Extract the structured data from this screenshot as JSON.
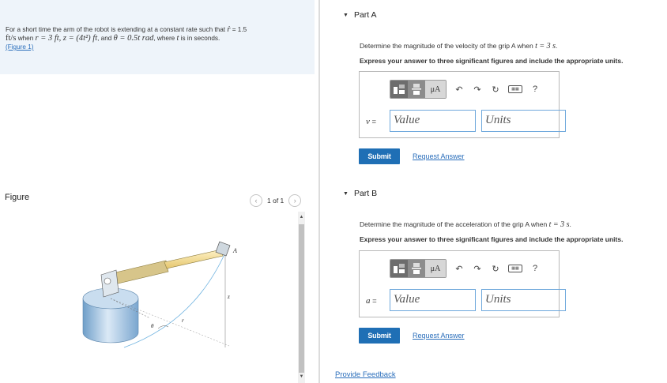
{
  "problem": {
    "text_pre": "For a short time the arm of the robot is extending at a constant rate such that ",
    "rdot_symbol": "ṙ",
    "rdot_value": " = 1.5",
    "units_fts": "ft/s",
    "when_r": " when ",
    "r_expr": "r = 3 ft, z = (4t²) ft",
    "and_theta": ", and ",
    "theta_expr": "θ = 0.5t rad",
    "where_t": ", where ",
    "t_symbol": "t",
    "seconds": " is in seconds.",
    "figure_link": "(Figure 1)"
  },
  "figure_panel": {
    "heading": "Figure",
    "pager_text": "1 of 1",
    "labels": {
      "A": "A",
      "z": "z",
      "r": "r",
      "theta": "θ"
    }
  },
  "part_a": {
    "title": "Part A",
    "question_pre": "Determine the magnitude of the velocity of the grip A when ",
    "question_math": "t = 3 s",
    "question_post": ".",
    "instruction": "Express your answer to three significant figures and include the appropriate units.",
    "variable": "v",
    "equals": " =",
    "value_placeholder": "Value",
    "units_placeholder": "Units",
    "submit": "Submit",
    "request": "Request Answer"
  },
  "part_b": {
    "title": "Part B",
    "question_pre": "Determine the magnitude of the acceleration of the grip A when ",
    "question_math": "t = 3 s",
    "question_post": ".",
    "instruction": "Express your answer to three significant figures and include the appropriate units.",
    "variable": "a",
    "equals": " =",
    "value_placeholder": "Value",
    "units_placeholder": "Units",
    "submit": "Submit",
    "request": "Request Answer"
  },
  "toolbar": {
    "mu": "μA",
    "help": "?"
  },
  "feedback": "Provide Feedback",
  "colors": {
    "link": "#2a6ebb",
    "submit_bg": "#1f6fb5",
    "problem_bg": "#eef4fa",
    "field_border": "#6fa8dc"
  }
}
